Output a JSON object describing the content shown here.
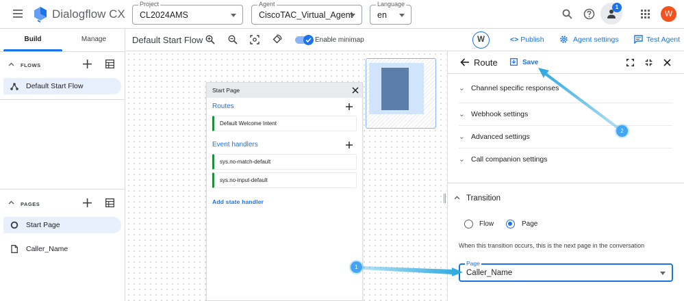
{
  "app": {
    "title": "Dialogflow CX"
  },
  "topbar": {
    "project": {
      "label": "Project",
      "value": "CL2024AMS"
    },
    "agent": {
      "label": "Agent",
      "value": "CiscoTAC_Virtual_Agent"
    },
    "language": {
      "label": "Language",
      "value": "en"
    },
    "notification_count": "1",
    "avatar_letter": "W"
  },
  "left": {
    "tabs": [
      "Build",
      "Manage"
    ],
    "flows_title": "FLOWS",
    "flows": [
      "Default Start Flow"
    ],
    "pages_title": "PAGES",
    "pages": [
      "Start Page",
      "Caller_Name"
    ]
  },
  "toolbar": {
    "flow_title": "Default Start Flow",
    "minimap_label": "Enable minimap",
    "minimap_enabled": true,
    "user_letter": "W",
    "publish": "Publish",
    "agent_settings": "Agent settings",
    "test_agent": "Test Agent"
  },
  "page_card": {
    "title": "Start Page",
    "routes_label": "Routes",
    "routes": [
      "Default Welcome Intent"
    ],
    "event_handlers_label": "Event handlers",
    "event_handlers": [
      "sys.no-match-default",
      "sys.no-input-default"
    ],
    "add_state_handler": "Add state handler"
  },
  "route_panel": {
    "title": "Route",
    "save": "Save",
    "sections": [
      "Channel specific responses",
      "Webhook settings",
      "Advanced settings",
      "Call companion settings"
    ],
    "transition_title": "Transition",
    "options": [
      "Flow",
      "Page"
    ],
    "selected_option": "Page",
    "hint": "When this transition occurs, this is the next page in the conversation",
    "page_field_label": "Page",
    "page_field_value": "Caller_Name"
  },
  "annotations": [
    "1",
    "2"
  ],
  "colors": {
    "accent": "#1a73e8",
    "selected_bg": "#e8f0fe",
    "arrow": "#29a8e0"
  }
}
